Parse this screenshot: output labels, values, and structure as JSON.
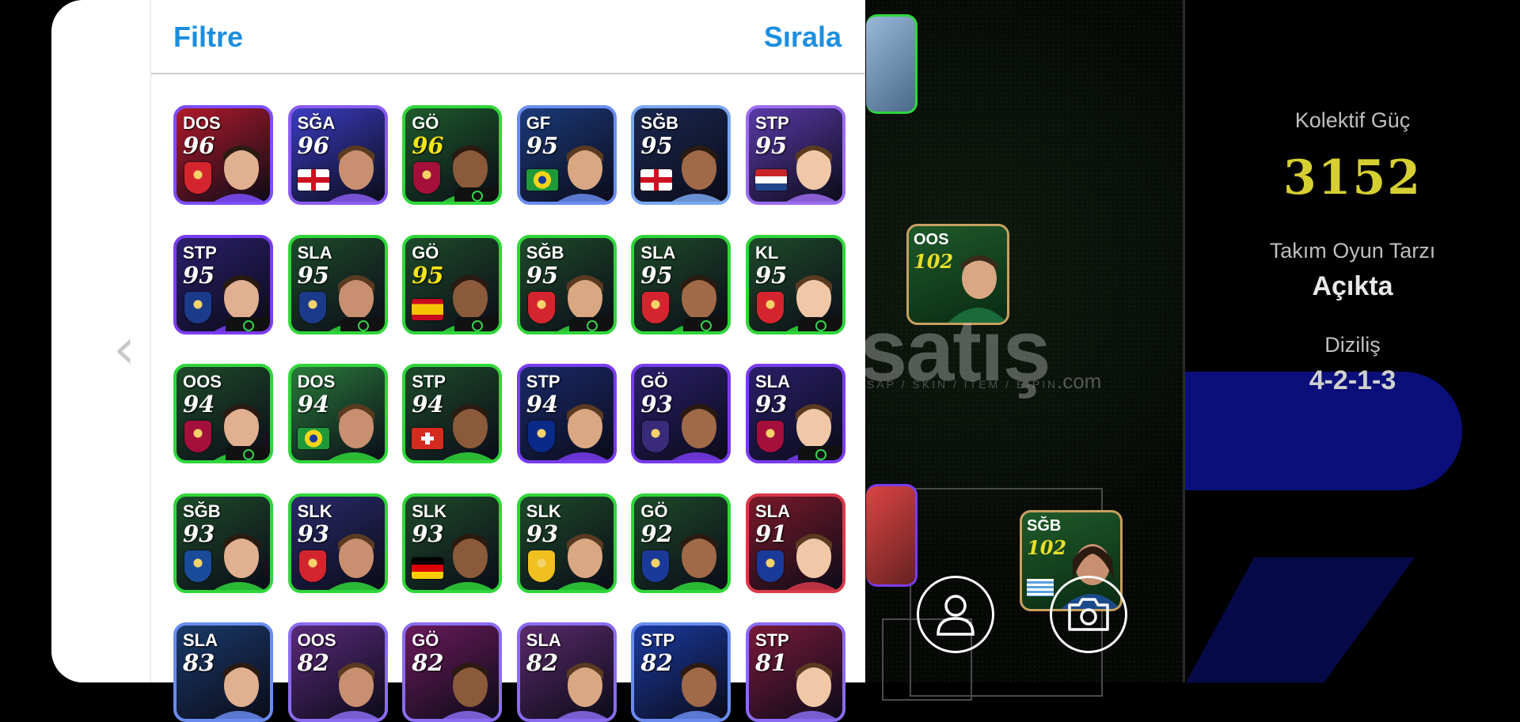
{
  "modal": {
    "filter_label": "Filtre",
    "sort_label": "Sırala",
    "back_glyph": "‹"
  },
  "players": [
    {
      "pos": "DOS",
      "rating": "96",
      "frame": "#7c4dff",
      "bg": "#b01a2a",
      "emblem": "crest",
      "emblem_color": "#d4252f",
      "rating_color": "#ffffff",
      "badge": false
    },
    {
      "pos": "SĞA",
      "rating": "96",
      "frame": "#8a5cf0",
      "bg": "#3a3cc0",
      "emblem": "flag-england",
      "emblem_color": "",
      "rating_color": "#ffffff",
      "badge": false
    },
    {
      "pos": "GÖ",
      "rating": "96",
      "frame": "#2fd63a",
      "bg": "#1e5a2a",
      "emblem": "crest",
      "emblem_color": "#a50f3b",
      "rating_color": "#f5e516",
      "badge": true
    },
    {
      "pos": "GF",
      "rating": "95",
      "frame": "#6a8cf0",
      "bg": "#1b3a7a",
      "emblem": "flag-brazil",
      "emblem_color": "",
      "rating_color": "#ffffff",
      "badge": false
    },
    {
      "pos": "SĞB",
      "rating": "95",
      "frame": "#7aa8f0",
      "bg": "#1a2850",
      "emblem": "flag-england",
      "emblem_color": "",
      "rating_color": "#ffffff",
      "badge": false
    },
    {
      "pos": "STP",
      "rating": "95",
      "frame": "#9b6cf0",
      "bg": "#5a3aa8",
      "emblem": "flag-netherlands",
      "emblem_color": "",
      "rating_color": "#ffffff",
      "badge": false
    },
    {
      "pos": "STP",
      "rating": "95",
      "frame": "#7a3cf0",
      "bg": "#2a1f6a",
      "emblem": "crest",
      "emblem_color": "#1b3a8a",
      "rating_color": "#ffffff",
      "badge": true
    },
    {
      "pos": "SLA",
      "rating": "95",
      "frame": "#2fd63a",
      "bg": "#1e4a2a",
      "emblem": "crest",
      "emblem_color": "#1b3a8a",
      "rating_color": "#ffffff",
      "badge": true
    },
    {
      "pos": "GÖ",
      "rating": "95",
      "frame": "#2fd63a",
      "bg": "#1e4a2a",
      "emblem": "flag-spain",
      "emblem_color": "",
      "rating_color": "#f5e516",
      "badge": true
    },
    {
      "pos": "SĞB",
      "rating": "95",
      "frame": "#2fd63a",
      "bg": "#1e4a2a",
      "emblem": "crest",
      "emblem_color": "#d4252f",
      "rating_color": "#ffffff",
      "badge": true
    },
    {
      "pos": "SLA",
      "rating": "95",
      "frame": "#2fd63a",
      "bg": "#1e4a2a",
      "emblem": "crest",
      "emblem_color": "#d4252f",
      "rating_color": "#ffffff",
      "badge": true
    },
    {
      "pos": "KL",
      "rating": "95",
      "frame": "#2fd63a",
      "bg": "#1e4a2a",
      "emblem": "crest",
      "emblem_color": "#d4252f",
      "rating_color": "#ffffff",
      "badge": true
    },
    {
      "pos": "OOS",
      "rating": "94",
      "frame": "#2fd63a",
      "bg": "#1e4a2a",
      "emblem": "crest",
      "emblem_color": "#a50f3b",
      "rating_color": "#ffffff",
      "badge": true
    },
    {
      "pos": "DOS",
      "rating": "94",
      "frame": "#2fd63a",
      "bg": "#2a7a3a",
      "emblem": "flag-brazil",
      "emblem_color": "",
      "rating_color": "#ffffff",
      "badge": false
    },
    {
      "pos": "STP",
      "rating": "94",
      "frame": "#2fd63a",
      "bg": "#1e4a2a",
      "emblem": "flag-switzerland",
      "emblem_color": "",
      "rating_color": "#ffffff",
      "badge": false
    },
    {
      "pos": "STP",
      "rating": "94",
      "frame": "#7a3cf0",
      "bg": "#1a2a6a",
      "emblem": "crest",
      "emblem_color": "#0a2a8a",
      "rating_color": "#ffffff",
      "badge": false
    },
    {
      "pos": "GÖ",
      "rating": "93",
      "frame": "#7a3cf0",
      "bg": "#2a1f6a",
      "emblem": "crest",
      "emblem_color": "#3a2a7a",
      "rating_color": "#ffffff",
      "badge": false
    },
    {
      "pos": "SLA",
      "rating": "93",
      "frame": "#7a3cf0",
      "bg": "#2a1f6a",
      "emblem": "crest",
      "emblem_color": "#a50f3b",
      "rating_color": "#ffffff",
      "badge": true
    },
    {
      "pos": "SĞB",
      "rating": "93",
      "frame": "#2fd63a",
      "bg": "#1e4a2a",
      "emblem": "crest",
      "emblem_color": "#1a4a9a",
      "rating_color": "#ffffff",
      "badge": false
    },
    {
      "pos": "SLK",
      "rating": "93",
      "frame": "#2fd63a",
      "bg": "#2a2a6a",
      "emblem": "crest",
      "emblem_color": "#d4252f",
      "rating_color": "#ffffff",
      "badge": false
    },
    {
      "pos": "SLK",
      "rating": "93",
      "frame": "#2fd63a",
      "bg": "#1e4a2a",
      "emblem": "flag-germany",
      "emblem_color": "",
      "rating_color": "#ffffff",
      "badge": false
    },
    {
      "pos": "SLK",
      "rating": "93",
      "frame": "#2fd63a",
      "bg": "#1e4a2a",
      "emblem": "crest",
      "emblem_color": "#f0c020",
      "rating_color": "#ffffff",
      "badge": false
    },
    {
      "pos": "GÖ",
      "rating": "92",
      "frame": "#2fd63a",
      "bg": "#1e4a2a",
      "emblem": "crest",
      "emblem_color": "#1a3a9a",
      "rating_color": "#ffffff",
      "badge": false
    },
    {
      "pos": "SLA",
      "rating": "91",
      "frame": "#d83a4a",
      "bg": "#7a1a2a",
      "emblem": "crest",
      "emblem_color": "#1a3a9a",
      "rating_color": "#ffffff",
      "badge": false
    },
    {
      "pos": "SLA",
      "rating": "83",
      "frame": "#6a8cf0",
      "bg": "#1a3a6a",
      "emblem": "",
      "emblem_color": "",
      "rating_color": "#ffffff",
      "badge": false
    },
    {
      "pos": "OOS",
      "rating": "82",
      "frame": "#8a6cf0",
      "bg": "#5a2a7a",
      "emblem": "",
      "emblem_color": "",
      "rating_color": "#ffffff",
      "badge": false
    },
    {
      "pos": "GÖ",
      "rating": "82",
      "frame": "#8a6cf0",
      "bg": "#6a1a5a",
      "emblem": "",
      "emblem_color": "",
      "rating_color": "#ffffff",
      "badge": false
    },
    {
      "pos": "SLA",
      "rating": "82",
      "frame": "#8a6cf0",
      "bg": "#5a2a6a",
      "emblem": "",
      "emblem_color": "",
      "rating_color": "#ffffff",
      "badge": false
    },
    {
      "pos": "STP",
      "rating": "82",
      "frame": "#6a8cf0",
      "bg": "#1a3aa0",
      "emblem": "",
      "emblem_color": "",
      "rating_color": "#ffffff",
      "badge": false
    },
    {
      "pos": "STP",
      "rating": "81",
      "frame": "#8a6cf0",
      "bg": "#7a1a3a",
      "emblem": "",
      "emblem_color": "",
      "rating_color": "#ffffff",
      "badge": false
    }
  ],
  "field_cards": [
    {
      "pos": "OOS",
      "rating": "102"
    },
    {
      "pos": "SĞB",
      "rating": "102"
    }
  ],
  "team": {
    "power_label": "Kolektif Güç",
    "power_value": "3152",
    "style_label": "Takım Oyun Tarzı",
    "style_value": "Açıkta",
    "formation_label": "Diziliş",
    "formation_value": "4-2-1-3"
  },
  "watermark": {
    "brand": "satış",
    "suffix": ".com",
    "sub": "SAP / SKIN / ITEM / E-PIN"
  },
  "icons": {
    "profile": "person-icon",
    "camera": "camera-icon"
  }
}
